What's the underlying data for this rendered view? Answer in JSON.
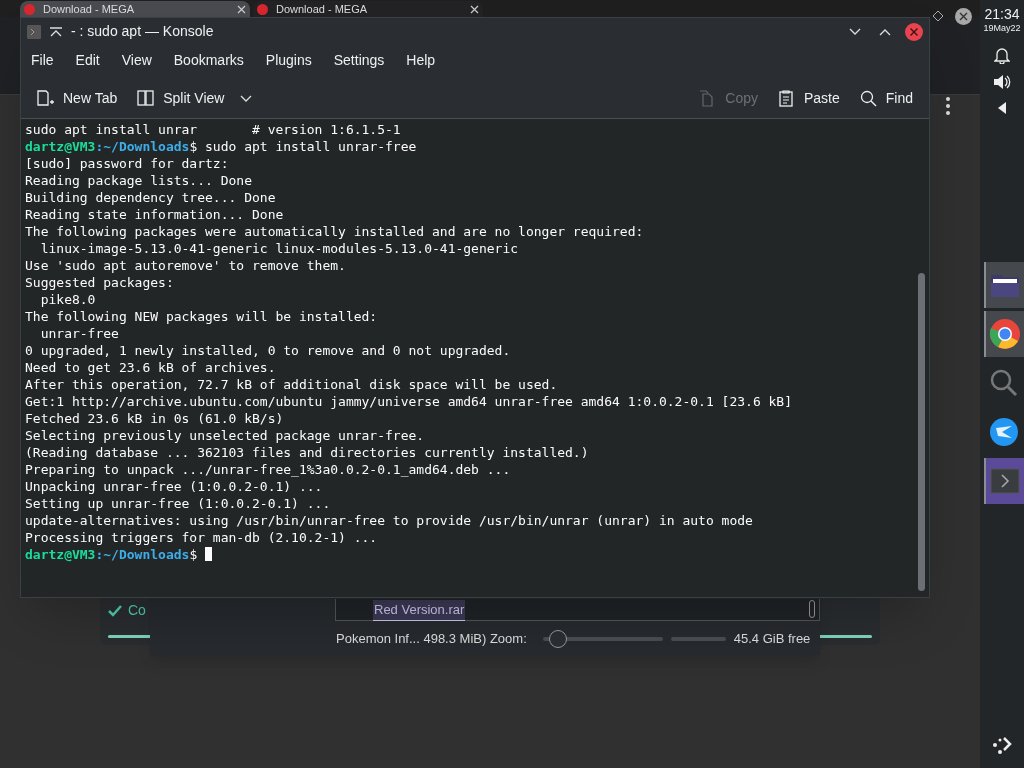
{
  "browser_tabs": [
    {
      "title": "Download - MEGA",
      "selected": true
    },
    {
      "title": "Download - MEGA",
      "selected": false
    }
  ],
  "background_card": {
    "status": "Co",
    "level": 1
  },
  "background_dialog": {
    "file": "Red Version.rar",
    "status": "Pokemon Inf... 498.3 MiB) Zoom:",
    "level": 0.13,
    "free": "45.4 GiB free"
  },
  "window": {
    "title": "- : sudo apt — Konsole"
  },
  "menu": [
    "File",
    "Edit",
    "View",
    "Bookmarks",
    "Plugins",
    "Settings",
    "Help"
  ],
  "toolbar_left": [
    {
      "kind": "new-tab",
      "label": "New Tab"
    },
    {
      "kind": "split",
      "label": "Split View"
    }
  ],
  "toolbar_right": [
    {
      "kind": "copy",
      "label": "Copy",
      "disabled": true
    },
    {
      "kind": "paste",
      "label": "Paste",
      "disabled": false
    },
    {
      "kind": "find",
      "label": "Find",
      "disabled": false
    }
  ],
  "terminal": [
    {
      "kind": "output",
      "text": "sudo apt install unrar       # version 1:6.1.5-1"
    },
    {
      "kind": "prompt",
      "user": "dartz@VM3",
      "path": ":~/Downloads",
      "command": "$ sudo apt install unrar-free"
    },
    {
      "kind": "output",
      "text": "[sudo] password for dartz:"
    },
    {
      "kind": "output",
      "text": "Reading package lists... Done"
    },
    {
      "kind": "output",
      "text": "Building dependency tree... Done"
    },
    {
      "kind": "output",
      "text": "Reading state information... Done"
    },
    {
      "kind": "output",
      "text": "The following packages were automatically installed and are no longer required:"
    },
    {
      "kind": "output",
      "text": "  linux-image-5.13.0-41-generic linux-modules-5.13.0-41-generic"
    },
    {
      "kind": "output",
      "text": "Use 'sudo apt autoremove' to remove them."
    },
    {
      "kind": "output",
      "text": "Suggested packages:"
    },
    {
      "kind": "output",
      "text": "  pike8.0"
    },
    {
      "kind": "output",
      "text": "The following NEW packages will be installed:"
    },
    {
      "kind": "output",
      "text": "  unrar-free"
    },
    {
      "kind": "output",
      "text": "0 upgraded, 1 newly installed, 0 to remove and 0 not upgraded."
    },
    {
      "kind": "output",
      "text": "Need to get 23.6 kB of archives."
    },
    {
      "kind": "output",
      "text": "After this operation, 72.7 kB of additional disk space will be used."
    },
    {
      "kind": "output",
      "text": "Get:1 http://archive.ubuntu.com/ubuntu jammy/universe amd64 unrar-free amd64 1:0.0.2-0.1 [23.6 kB]"
    },
    {
      "kind": "output",
      "text": "Fetched 23.6 kB in 0s (61.0 kB/s)"
    },
    {
      "kind": "output",
      "text": "Selecting previously unselected package unrar-free."
    },
    {
      "kind": "output",
      "text": "(Reading database ... 362103 files and directories currently installed.)"
    },
    {
      "kind": "output",
      "text": "Preparing to unpack .../unrar-free_1%3a0.0.2-0.1_amd64.deb ..."
    },
    {
      "kind": "output",
      "text": "Unpacking unrar-free (1:0.0.2-0.1) ..."
    },
    {
      "kind": "output",
      "text": "Setting up unrar-free (1:0.0.2-0.1) ..."
    },
    {
      "kind": "output",
      "text": "update-alternatives: using /usr/bin/unrar-free to provide /usr/bin/unrar (unrar) in auto mode"
    },
    {
      "kind": "output",
      "text": "Processing triggers for man-db (2.10.2-1) ..."
    },
    {
      "kind": "prompt",
      "user": "dartz@VM3",
      "path": ":~/Downloads",
      "command": "$ ",
      "cursor": true
    }
  ],
  "panel": {
    "time": "21:34",
    "date": "19May22"
  },
  "tasks": [
    {
      "kind": "folder",
      "open": true,
      "selected": false
    },
    {
      "kind": "browser",
      "open": true,
      "selected": false
    },
    {
      "kind": "search",
      "open": false,
      "selected": false
    },
    {
      "kind": "app",
      "open": false,
      "selected": false
    },
    {
      "kind": "terminal",
      "open": true,
      "selected": true
    }
  ]
}
